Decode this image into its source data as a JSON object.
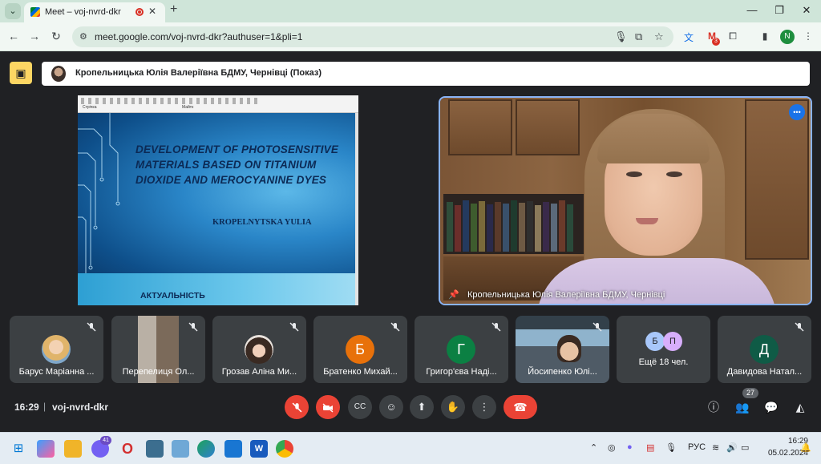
{
  "browser": {
    "tab_title": "Meet – voj-nvrd-dkr",
    "url": "meet.google.com/voj-nvrd-dkr?authuser=1&pli=1",
    "profile_letter": "N",
    "ext_badge": "3"
  },
  "meet": {
    "presenting_text": "Кропельницька Юлія Валеріївна БДМУ, Чернівці (Показ)",
    "slide": {
      "toolbar_left": "Стрічка",
      "toolbar_right": "Майтк",
      "title": "DEVELOPMENT OF PHOTOSENSITIVE MATERIALS BASED ON TITANIUM DIOXIDE AND MEROCYANINE DYES",
      "author": "KROPELNYTSKA YULIA",
      "next_title": "АКТУАЛЬНІСТЬ"
    },
    "speaker_name": "Кропельницька Юлія Валеріївна БДМУ, Чернівці",
    "participants": [
      {
        "name": "Барус Маріанна ...",
        "type": "photo"
      },
      {
        "name": "Перепелиця Ол...",
        "type": "video"
      },
      {
        "name": "Грозав Аліна Ми...",
        "type": "photo"
      },
      {
        "name": "Братенко Михай...",
        "type": "letter",
        "letter": "Б",
        "color": "#e8710a"
      },
      {
        "name": "Григор'єва Наді...",
        "type": "letter",
        "letter": "Г",
        "color": "#0b8043"
      },
      {
        "name": "Йосипенко Юлі...",
        "type": "video"
      },
      {
        "name": "Ещё 18 чел.",
        "type": "more",
        "letters": [
          "Б",
          "П"
        ]
      },
      {
        "name": "Давидова Натал...",
        "type": "letter",
        "letter": "Д",
        "color": "#0f5b46"
      }
    ],
    "time": "16:29",
    "meeting_code": "voj-nvrd-dkr",
    "people_count": "27"
  },
  "taskbar": {
    "viber_badge": "41",
    "lang": "РУС",
    "time": "16:29",
    "date": "05.02.2024"
  },
  "colors": {
    "accent_red": "#ea4335",
    "present_yellow": "#fdd663",
    "active_border": "#8ab4f8"
  }
}
